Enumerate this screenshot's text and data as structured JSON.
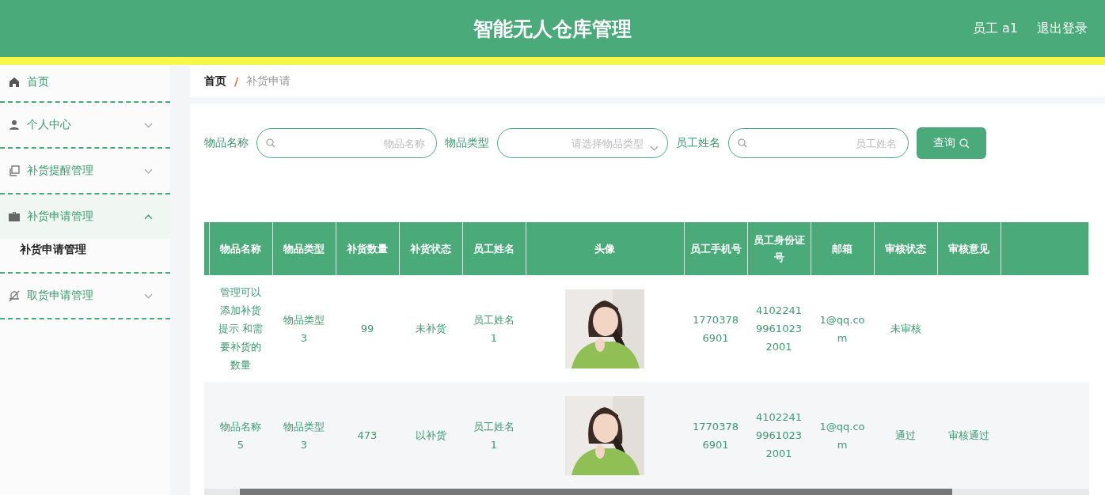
{
  "header": {
    "title": "智能无人仓库管理",
    "user": "员工 a1",
    "logout": "退出登录"
  },
  "sidebar": {
    "items": [
      {
        "label": "首页"
      },
      {
        "label": "个人中心",
        "expanded": false
      },
      {
        "label": "补货提醒管理",
        "expanded": false
      },
      {
        "label": "补货申请管理",
        "expanded": true,
        "children": [
          {
            "label": "补货申请管理"
          }
        ]
      },
      {
        "label": "取货申请管理",
        "expanded": false
      }
    ]
  },
  "breadcrumb": {
    "items": [
      "首页",
      "补货申请"
    ],
    "separator": "/"
  },
  "search": {
    "fields": [
      {
        "label": "物品名称",
        "placeholder": "物品名称",
        "kind": "input"
      },
      {
        "label": "物品类型",
        "placeholder": "请选择物品类型",
        "kind": "select"
      },
      {
        "label": "员工姓名",
        "placeholder": "员工姓名",
        "kind": "input"
      }
    ],
    "button": "查询"
  },
  "table": {
    "columns": [
      "物品名称",
      "物品类型",
      "补货数量",
      "补货状态",
      "员工姓名",
      "头像",
      "员工手机号",
      "员工身份证号",
      "邮箱",
      "审核状态",
      "审核意见"
    ],
    "rows": [
      {
        "cells": [
          "管理可以添加补货提示 和需要补货的数量",
          "物品类型3",
          "99",
          "未补货",
          "员工姓名1",
          {
            "kind": "picture"
          },
          "17703786901",
          "410224199610232001",
          "1@qq.com",
          "未审核",
          ""
        ]
      },
      {
        "cells": [
          "物品名称5",
          "物品类型3",
          "473",
          "以补货",
          "员工姓名1",
          {
            "kind": "picture"
          },
          "17703786901",
          "410224199610232001",
          "1@qq.com",
          "通过",
          "审核通过"
        ]
      }
    ]
  }
}
